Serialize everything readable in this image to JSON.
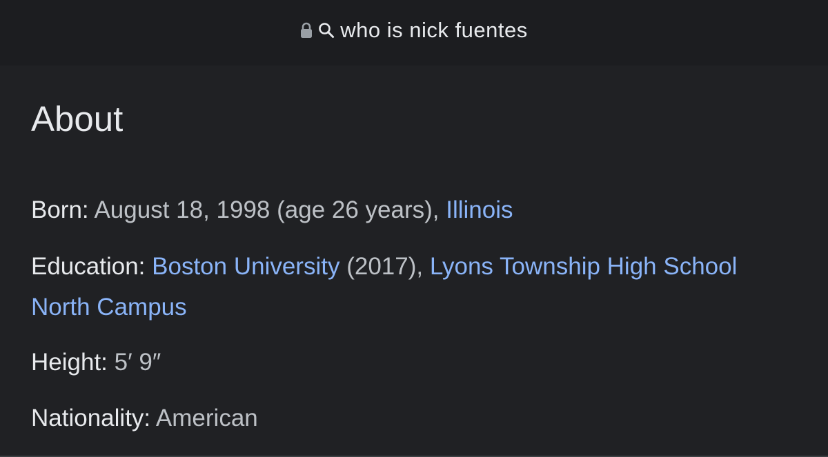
{
  "address_bar": {
    "query": "who is nick fuentes",
    "lock_icon": "lock-icon",
    "search_icon": "search-icon"
  },
  "about": {
    "heading": "About",
    "born": {
      "label": "Born:",
      "value": " August 18, 1998 (age 26 years), ",
      "place_link": "Illinois"
    },
    "education": {
      "label": "Education:",
      "school1_link": "Boston University",
      "school1_year": " (2017), ",
      "school2_link": "Lyons Township High School North Campus"
    },
    "height": {
      "label": "Height:",
      "value": " 5′ 9″"
    },
    "nationality": {
      "label": "Nationality:",
      "value": " American"
    }
  },
  "colors": {
    "background": "#202124",
    "address_bar": "#1c1d20",
    "text_primary": "#e8eaed",
    "text_secondary": "#bdc1c6",
    "link": "#8ab4f8"
  }
}
